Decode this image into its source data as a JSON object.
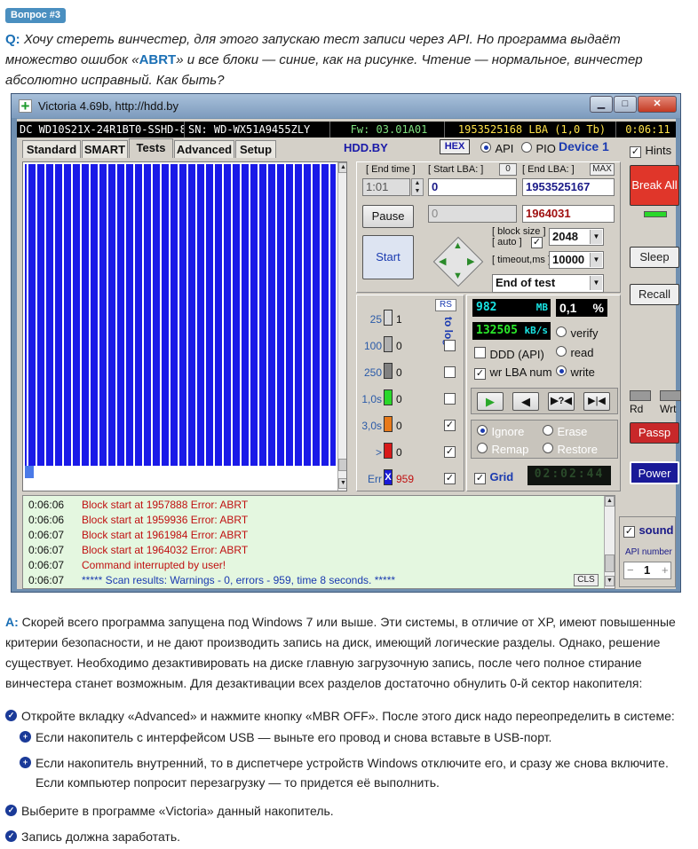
{
  "article": {
    "badge": "Вопрос #3",
    "q_label": "Q:",
    "q_text_1": " Хочу стереть винчестер, для этого запускаю тест записи через API. Но программа выдаёт множество ошибок «",
    "q_abrt": "ABRT",
    "q_text_2": "» и все блоки — синие, как на рисунке. Чтение — нормальное, винчестер абсолютно исправный. Как быть?",
    "a_label": "A:",
    "a_text": " Скорей всего программа запущена под Windows 7 или выше. Эти системы, в отличие от XP, имеют повышенные критерии безопасности, и не дают производить запись на диск, имеющий логические разделы. Однако, решение существует. Необходимо дезактивировать на диске главную загрузочную запись, после чего полное стирание винчестера станет возможным. Для дезактивации всех разделов достаточно обнулить 0-й сектор накопителя:",
    "steps": [
      "Откройте вкладку «Advanced» и нажмите кнопку «MBR OFF». После этого диск надо переопределить в системе:",
      "Если накопитель с интерфейсом USB — выньте его провод и снова вставьте в USB-порт.",
      "Если накопитель внутренний, то в диспетчере устройств Windows отключите его, и сразу же снова включите. Если компьютер попросит перезагрузку — то придется её выполнить.",
      "Выберите в программе «Victoria» данный накопитель.",
      "Запись должна заработать."
    ]
  },
  "window": {
    "title": "Victoria 4.69b, http://hdd.by",
    "status": {
      "model": "DC WD10S21X-24R1BT0-SSHD-8",
      "serial": "SN: WD-WX51A9455ZLY",
      "firmware": "Fw: 03.01A01",
      "lba": "1953525168 LBA (1,0 Tb)",
      "time": "0:06:11"
    },
    "tabs": [
      "Standard",
      "SMART",
      "Tests",
      "Advanced",
      "Setup"
    ],
    "active_tab": "Tests",
    "hdd_by": "HDD.BY",
    "hex": "HEX",
    "api": "API",
    "pio": "PIO",
    "device": "Device 1",
    "hints": "Hints",
    "end_time_label": "[ End time ]",
    "end_time_value": "1:01",
    "start_lba_label": "[ Start LBA: ]",
    "start_lba_zero": "0",
    "start_lba_value": "0",
    "start_lba_value2": "0",
    "end_lba_label": "[ End LBA: ]",
    "end_lba_max": "MAX",
    "end_lba_value": "1953525167",
    "end_lba_value2": "1964031",
    "pause": "Pause",
    "start": "Start",
    "block_size_label": "[ block size ]",
    "auto_label": "[ auto ]",
    "block_size": "2048",
    "timeout_label": "[ timeout,ms ]",
    "timeout": "10000",
    "end_of_test": "End of test",
    "break_all": "Break All",
    "sleep": "Sleep",
    "recall": "Recall",
    "rd": "Rd",
    "wrt": "Wrt",
    "passp": "Passp",
    "power": "Power",
    "sound": "sound",
    "api_number_label": "API number",
    "api_number": "1",
    "rs": "RS",
    "to_log": "to log:",
    "counters": [
      {
        "label": "25",
        "value": "1",
        "color": "#d8d8d8"
      },
      {
        "label": "100",
        "value": "0",
        "color": "#b0b0b0"
      },
      {
        "label": "250",
        "value": "0",
        "color": "#808080"
      },
      {
        "label": "1,0s",
        "value": "0",
        "color": "#2ad82a"
      },
      {
        "label": "3,0s",
        "value": "0",
        "color": "#e87a1a"
      },
      {
        "label": ">",
        "value": "0",
        "color": "#d81a1a"
      },
      {
        "label": "Err",
        "value": "959",
        "color": "#1a1ad8"
      }
    ],
    "mb_value": "982",
    "mb_unit": "MB",
    "pct_value": "0,1",
    "pct_unit": "%",
    "speed_value": "132505",
    "speed_unit": "kB/s",
    "ddd": "DDD (API)",
    "wr_lba": "wr LBA num",
    "verify": "verify",
    "read": "read",
    "write": "write",
    "ignore": "Ignore",
    "erase": "Erase",
    "remap": "Remap",
    "restore": "Restore",
    "grid": "Grid",
    "grid_time": "02:02:44",
    "cls": "CLS",
    "log": [
      {
        "time": "0:06:06",
        "msg": "Block start at 1957888 Error: ABRT",
        "kind": "err"
      },
      {
        "time": "0:06:06",
        "msg": "Block start at 1959936 Error: ABRT",
        "kind": "err"
      },
      {
        "time": "0:06:07",
        "msg": "Block start at 1961984 Error: ABRT",
        "kind": "err"
      },
      {
        "time": "0:06:07",
        "msg": "Block start at 1964032 Error: ABRT",
        "kind": "err"
      },
      {
        "time": "0:06:07",
        "msg": "Command interrupted by user!",
        "kind": "err"
      },
      {
        "time": "0:06:07",
        "msg": "***** Scan results: Warnings - 0, errors - 959, time 8 seconds. *****",
        "kind": "info"
      }
    ]
  }
}
